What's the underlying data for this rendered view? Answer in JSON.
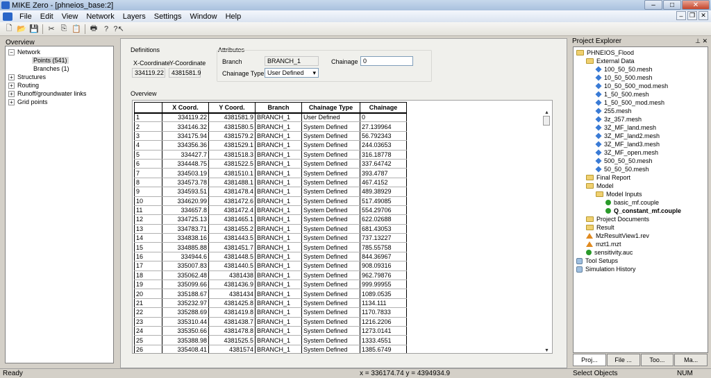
{
  "window": {
    "title": "MIKE Zero - [phneios_base:2]"
  },
  "menu": [
    "File",
    "Edit",
    "View",
    "Network",
    "Layers",
    "Settings",
    "Window",
    "Help"
  ],
  "toolbar": [
    "new-icon",
    "open-icon",
    "save-icon",
    "cut-icon",
    "copy-icon",
    "paste-icon",
    "print-icon",
    "help-icon",
    "context-help-icon"
  ],
  "left": {
    "title": "Overview",
    "tree": {
      "network": "Network",
      "points": "Points (541)",
      "branches": "Branches (1)",
      "structures": "Structures",
      "routing": "Routing",
      "runoff": "Runoff/groundwater links",
      "grid": "Grid points"
    }
  },
  "definitions": {
    "title": "Definitions",
    "x_label": "X-Coordinate",
    "y_label": "Y-Coordinate",
    "x_value": "334119.22",
    "y_value": "4381581.9"
  },
  "attributes": {
    "title": "Attributes",
    "branch_label": "Branch",
    "branch_value": "BRANCH_1",
    "chainage_label": "Chainage",
    "chainage_value": "0",
    "chainage_type_label": "Chainage Type",
    "chainage_type_value": "User Defined"
  },
  "overview": {
    "title": "Overview",
    "columns": [
      "X Coord.",
      "Y Coord.",
      "Branch",
      "Chainage Type",
      "Chainage"
    ],
    "rows": [
      [
        "1",
        "334119.22",
        "4381581.9",
        "BRANCH_1",
        "User Defined",
        "0"
      ],
      [
        "2",
        "334146.32",
        "4381580.5",
        "BRANCH_1",
        "System Defined",
        "27.139964"
      ],
      [
        "3",
        "334175.94",
        "4381579.2",
        "BRANCH_1",
        "System Defined",
        "56.792343"
      ],
      [
        "4",
        "334356.36",
        "4381529.1",
        "BRANCH_1",
        "System Defined",
        "244.03653"
      ],
      [
        "5",
        "334427.7",
        "4381518.3",
        "BRANCH_1",
        "System Defined",
        "316.18778"
      ],
      [
        "6",
        "334448.75",
        "4381522.5",
        "BRANCH_1",
        "System Defined",
        "337.64742"
      ],
      [
        "7",
        "334503.19",
        "4381510.1",
        "BRANCH_1",
        "System Defined",
        "393.4787"
      ],
      [
        "8",
        "334573.78",
        "4381488.1",
        "BRANCH_1",
        "System Defined",
        "467.4152"
      ],
      [
        "9",
        "334593.51",
        "4381478.4",
        "BRANCH_1",
        "System Defined",
        "489.38929"
      ],
      [
        "10",
        "334620.99",
        "4381472.6",
        "BRANCH_1",
        "System Defined",
        "517.49085"
      ],
      [
        "11",
        "334657.8",
        "4381472.4",
        "BRANCH_1",
        "System Defined",
        "554.29706"
      ],
      [
        "12",
        "334725.13",
        "4381465.1",
        "BRANCH_1",
        "System Defined",
        "622.02688"
      ],
      [
        "13",
        "334783.71",
        "4381455.2",
        "BRANCH_1",
        "System Defined",
        "681.43053"
      ],
      [
        "14",
        "334838.16",
        "4381443.5",
        "BRANCH_1",
        "System Defined",
        "737.13227"
      ],
      [
        "15",
        "334885.88",
        "4381451.7",
        "BRANCH_1",
        "System Defined",
        "785.55758"
      ],
      [
        "16",
        "334944.6",
        "4381448.5",
        "BRANCH_1",
        "System Defined",
        "844.36967"
      ],
      [
        "17",
        "335007.83",
        "4381440.5",
        "BRANCH_1",
        "System Defined",
        "908.09316"
      ],
      [
        "18",
        "335062.48",
        "4381438",
        "BRANCH_1",
        "System Defined",
        "962.79876"
      ],
      [
        "19",
        "335099.66",
        "4381436.9",
        "BRANCH_1",
        "System Defined",
        "999.99955"
      ],
      [
        "20",
        "335188.67",
        "4381434",
        "BRANCH_1",
        "System Defined",
        "1089.0535"
      ],
      [
        "21",
        "335232.97",
        "4381425.8",
        "BRANCH_1",
        "System Defined",
        "1134.111"
      ],
      [
        "22",
        "335288.69",
        "4381419.8",
        "BRANCH_1",
        "System Defined",
        "1170.7833"
      ],
      [
        "23",
        "335310.44",
        "4381438.7",
        "BRANCH_1",
        "System Defined",
        "1216.2206"
      ],
      [
        "24",
        "335350.66",
        "4381478.8",
        "BRANCH_1",
        "System Defined",
        "1273.0141"
      ],
      [
        "25",
        "335388.98",
        "4381525.5",
        "BRANCH_1",
        "System Defined",
        "1333.4551"
      ],
      [
        "26",
        "335408.41",
        "4381574",
        "BRANCH_1",
        "System Defined",
        "1385.6749"
      ]
    ]
  },
  "explorer": {
    "title": "Project Explorer",
    "items": [
      {
        "label": "PHNEIOS_Flood",
        "type": "folder",
        "level": 0
      },
      {
        "label": "External Data",
        "type": "folder",
        "level": 1
      },
      {
        "label": "100_50_50.mesh",
        "type": "mesh",
        "level": 2
      },
      {
        "label": "10_50_500.mesh",
        "type": "mesh",
        "level": 2
      },
      {
        "label": "10_50_500_mod.mesh",
        "type": "mesh",
        "level": 2
      },
      {
        "label": "1_50_500.mesh",
        "type": "mesh",
        "level": 2
      },
      {
        "label": "1_50_500_mod.mesh",
        "type": "mesh",
        "level": 2
      },
      {
        "label": "255.mesh",
        "type": "mesh",
        "level": 2
      },
      {
        "label": "3z_357.mesh",
        "type": "mesh",
        "level": 2
      },
      {
        "label": "3Z_MF_land.mesh",
        "type": "mesh",
        "level": 2
      },
      {
        "label": "3Z_MF_land2.mesh",
        "type": "mesh",
        "level": 2
      },
      {
        "label": "3Z_MF_land3.mesh",
        "type": "mesh",
        "level": 2
      },
      {
        "label": "3Z_MF_open.mesh",
        "type": "mesh",
        "level": 2
      },
      {
        "label": "500_50_50.mesh",
        "type": "mesh",
        "level": 2
      },
      {
        "label": "50_50_50.mesh",
        "type": "mesh",
        "level": 2
      },
      {
        "label": "Final Report",
        "type": "folder",
        "level": 1
      },
      {
        "label": "Model",
        "type": "folder",
        "level": 1
      },
      {
        "label": "Model Inputs",
        "type": "folder",
        "level": 2
      },
      {
        "label": "basic_mf.couple",
        "type": "green",
        "level": 3
      },
      {
        "label": "Q_constant_mf.couple",
        "type": "green",
        "level": 3,
        "bold": true
      },
      {
        "label": "Project Documents",
        "type": "folder",
        "level": 1
      },
      {
        "label": "Result",
        "type": "folder",
        "level": 1
      },
      {
        "label": "MzResultView1.rev",
        "type": "orange",
        "level": 1
      },
      {
        "label": "mzt1.mzt",
        "type": "orange",
        "level": 1
      },
      {
        "label": "sensitivity.auc",
        "type": "green",
        "level": 1
      },
      {
        "label": "Tool Setups",
        "type": "misc",
        "level": 0
      },
      {
        "label": "Simulation History",
        "type": "misc",
        "level": 0
      }
    ],
    "tabs": [
      "Proj...",
      "File ...",
      "Too...",
      "Ma..."
    ]
  },
  "status": {
    "ready": "Ready",
    "coords": "x = 336174.74  y = 4394934.9",
    "mode": "Select Objects",
    "num": "NUM"
  }
}
